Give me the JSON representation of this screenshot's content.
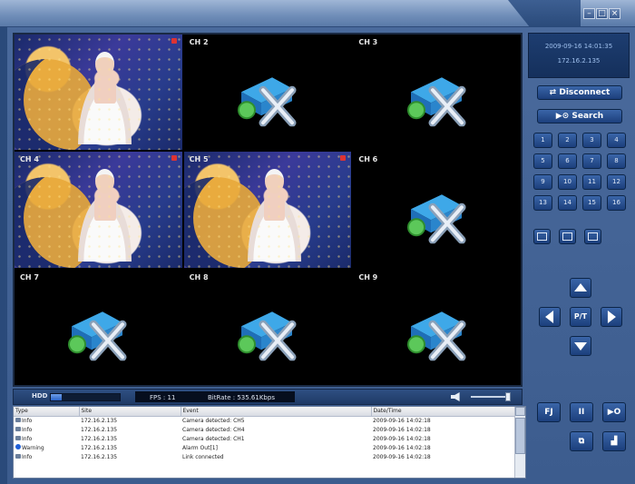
{
  "window": {
    "controls": {
      "minimize": "–",
      "maximize": "□",
      "close": "×"
    }
  },
  "channels": [
    {
      "label": "",
      "state": "video"
    },
    {
      "label": "CH 2",
      "state": "disconnected"
    },
    {
      "label": "CH 3",
      "state": "disconnected"
    },
    {
      "label": "CH 4",
      "state": "video"
    },
    {
      "label": "CH 5",
      "state": "video"
    },
    {
      "label": "CH 6",
      "state": "disconnected"
    },
    {
      "label": "CH 7",
      "state": "disconnected"
    },
    {
      "label": "CH 8",
      "state": "disconnected"
    },
    {
      "label": "CH 9",
      "state": "disconnected"
    }
  ],
  "status": {
    "hdd_label": "HDD",
    "hdd_usage": 0.16,
    "fps": "FPS : 11",
    "bitrate": "BitRate : 535.61Kbps"
  },
  "log": {
    "columns": [
      "Type",
      "Site",
      "Event",
      "Date/Time"
    ],
    "rows": [
      {
        "type": "Info",
        "icon": "info-icon",
        "site": "172.16.2.135",
        "event": "Camera detected: CH5",
        "datetime": "2009-09-16 14:02:18"
      },
      {
        "type": "Info",
        "icon": "info-icon",
        "site": "172.16.2.135",
        "event": "Camera detected: CH4",
        "datetime": "2009-09-16 14:02:18"
      },
      {
        "type": "Info",
        "icon": "info-icon",
        "site": "172.16.2.135",
        "event": "Camera detected: CH1",
        "datetime": "2009-09-16 14:02:18"
      },
      {
        "type": "Warning",
        "icon": "warning-icon",
        "site": "172.16.2.135",
        "event": "Alarm Out[1]",
        "datetime": "2009-09-16 14:02:18"
      },
      {
        "type": "Info",
        "icon": "info-icon",
        "site": "172.16.2.135",
        "event": "Link connected",
        "datetime": "2009-09-16 14:02:18"
      }
    ]
  },
  "info": {
    "datetime": "2009-09-16 14:01:35",
    "ip": "172.16.2.135"
  },
  "buttons": {
    "disconnect": "Disconnect",
    "search": "Search",
    "channels": [
      "1",
      "2",
      "3",
      "4",
      "5",
      "6",
      "7",
      "8",
      "9",
      "10",
      "11",
      "12",
      "13",
      "14",
      "15",
      "16"
    ],
    "ptz_center": "P/T",
    "fj": "FJ",
    "pause": "II",
    "next": "▶O"
  },
  "colors": {
    "panel": "#3c5c8e",
    "button": "#2a4f92",
    "accent": "#9fc0ee"
  }
}
